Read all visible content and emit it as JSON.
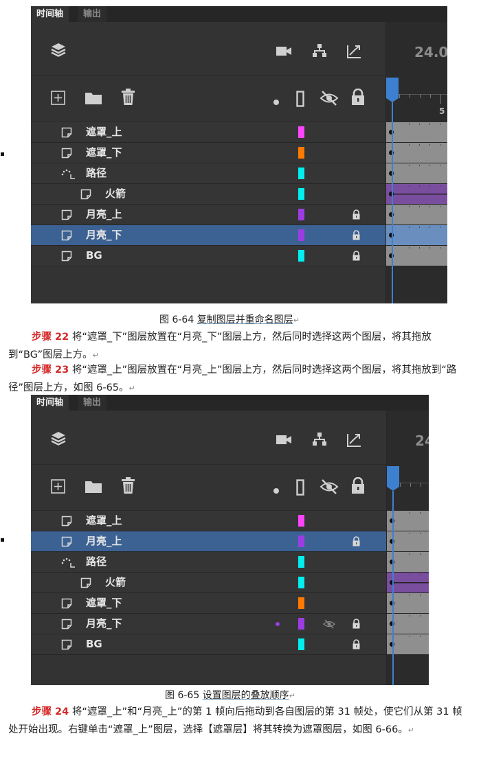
{
  "figures": [
    {
      "tabs": {
        "active": "时间轴",
        "inactive": "输出"
      },
      "fps": "24.0",
      "ruler_mark": "5",
      "layers": [
        {
          "name": "遮罩_上",
          "color": "#ff44ff",
          "icon": "layer-icon",
          "indent": false,
          "locked": false,
          "selected": false,
          "frame_color": "#8f8f8f"
        },
        {
          "name": "遮罩_下",
          "color": "#ff7a00",
          "icon": "layer-icon",
          "indent": false,
          "locked": false,
          "selected": false,
          "frame_color": "#8f8f8f"
        },
        {
          "name": "路径",
          "color": "#00f0f0",
          "icon": "guide-icon",
          "indent": false,
          "locked": false,
          "selected": false,
          "frame_color": "#8f8f8f"
        },
        {
          "name": "火箭",
          "color": "#00f0f0",
          "icon": "layer-icon",
          "indent": true,
          "locked": false,
          "selected": false,
          "frame_color": "#7a4e9e",
          "tween": true
        },
        {
          "name": "月亮_上",
          "color": "#9b3de3",
          "icon": "layer-icon",
          "indent": false,
          "locked": true,
          "selected": false,
          "frame_color": "#8f8f8f"
        },
        {
          "name": "月亮_下",
          "color": "#9b3de3",
          "icon": "layer-icon",
          "indent": false,
          "locked": true,
          "selected": true,
          "frame_color": "#6a8fbf"
        },
        {
          "name": "BG",
          "color": "#00f0f0",
          "icon": "layer-icon",
          "indent": false,
          "locked": true,
          "selected": false,
          "frame_color": "#8f8f8f"
        }
      ],
      "caption": {
        "prefix": "图 6-64 ",
        "title": "复制图层并重命名图层"
      }
    },
    {
      "tabs": {
        "active": "时间轴",
        "inactive": "输出"
      },
      "fps": "24",
      "ruler_mark": "",
      "layers": [
        {
          "name": "遮罩_上",
          "color": "#ff44ff",
          "icon": "layer-icon",
          "indent": false,
          "locked": false,
          "selected": false,
          "frame_color": "#8f8f8f"
        },
        {
          "name": "月亮_上",
          "color": "#9b3de3",
          "icon": "layer-icon",
          "indent": false,
          "locked": true,
          "selected": true,
          "frame_color": "#8f8f8f"
        },
        {
          "name": "路径",
          "color": "#00f0f0",
          "icon": "guide-icon",
          "indent": false,
          "locked": false,
          "selected": false,
          "frame_color": "#8f8f8f"
        },
        {
          "name": "火箭",
          "color": "#00f0f0",
          "icon": "layer-icon",
          "indent": true,
          "locked": false,
          "selected": false,
          "frame_color": "#7a4e9e",
          "tween": true
        },
        {
          "name": "遮罩_下",
          "color": "#ff7a00",
          "icon": "layer-icon",
          "indent": false,
          "locked": false,
          "selected": false,
          "frame_color": "#8f8f8f"
        },
        {
          "name": "月亮_下",
          "color": "#9b3de3",
          "icon": "layer-icon",
          "indent": false,
          "locked": true,
          "selected": false,
          "frame_color": "#8f8f8f",
          "hidden": true
        },
        {
          "name": "BG",
          "color": "#00f0f0",
          "icon": "layer-icon",
          "indent": false,
          "locked": true,
          "selected": false,
          "frame_color": "#8f8f8f"
        }
      ],
      "caption": {
        "prefix": "图 6-65 ",
        "title": "设置图层的叠放顺序"
      }
    }
  ],
  "steps": {
    "s22": {
      "label": "步骤 22",
      "text": " 将“遮罩_下”图层放置在“月亮_下”图层上方，然后同时选择这两个图层，将其拖放到“BG”图层上方。"
    },
    "s23": {
      "label": "步骤 23",
      "text": " 将“遮罩_上”图层放置在“月亮_上”图层上方，然后同时选择这两个图层，将其拖放到“路径”图层上方，如图 6-65。"
    },
    "s24": {
      "label": "步骤 24",
      "text": " 将“遮罩_上”和“月亮_上”的第 1 帧向后拖动到各自图层的第 31 帧处，使它们从第 31 帧处开始出现。右键单击“遮罩_上”图层，选择【遮罩层】将其转换为遮罩图层，如图 6-66。"
    }
  },
  "return_mark": "↵"
}
